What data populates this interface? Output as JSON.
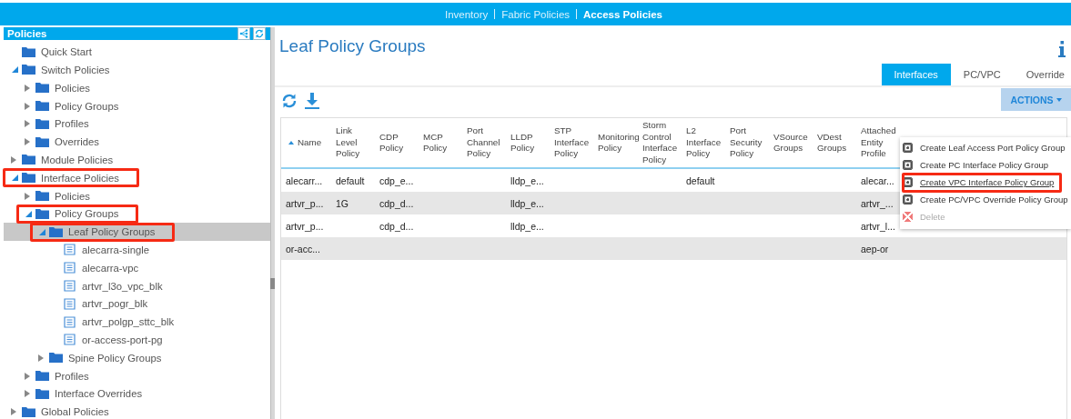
{
  "top_nav": [
    {
      "label": "Inventory",
      "selected": false
    },
    {
      "label": "Fabric Policies",
      "selected": false
    },
    {
      "label": "Access Policies",
      "selected": true
    }
  ],
  "sidebar": {
    "title": "Policies",
    "tree": [
      {
        "label": "Quick Start",
        "kind": "folder"
      },
      {
        "label": "Switch Policies",
        "kind": "folder",
        "expanded": true,
        "children": [
          {
            "label": "Policies",
            "kind": "folder",
            "expanded": false
          },
          {
            "label": "Policy Groups",
            "kind": "folder",
            "expanded": false
          },
          {
            "label": "Profiles",
            "kind": "folder",
            "expanded": false
          },
          {
            "label": "Overrides",
            "kind": "folder",
            "expanded": false
          }
        ]
      },
      {
        "label": "Module Policies",
        "kind": "folder",
        "expanded": false
      },
      {
        "label": "Interface Policies",
        "kind": "folder",
        "expanded": true,
        "highlighted": true,
        "children": [
          {
            "label": "Policies",
            "kind": "folder",
            "expanded": false
          },
          {
            "label": "Policy Groups",
            "kind": "folder",
            "expanded": true,
            "highlighted": true,
            "children": [
              {
                "label": "Leaf Policy Groups",
                "kind": "folder",
                "expanded": true,
                "selected": true,
                "highlighted": true,
                "children": [
                  {
                    "label": "alecarra-single",
                    "kind": "document"
                  },
                  {
                    "label": "alecarra-vpc",
                    "kind": "document"
                  },
                  {
                    "label": "artvr_l3o_vpc_blk",
                    "kind": "document"
                  },
                  {
                    "label": "artvr_pogr_blk",
                    "kind": "document"
                  },
                  {
                    "label": "artvr_polgp_sttc_blk",
                    "kind": "document"
                  },
                  {
                    "label": "or-access-port-pg",
                    "kind": "document"
                  }
                ]
              },
              {
                "label": "Spine Policy Groups",
                "kind": "folder",
                "expanded": false
              }
            ]
          },
          {
            "label": "Profiles",
            "kind": "folder",
            "expanded": false
          },
          {
            "label": "Interface Overrides",
            "kind": "folder",
            "expanded": false
          }
        ]
      },
      {
        "label": "Global Policies",
        "kind": "folder",
        "expanded": false
      }
    ]
  },
  "main": {
    "title": "Leaf Policy Groups",
    "tabs": [
      {
        "label": "Interfaces",
        "selected": true
      },
      {
        "label": "PC/VPC",
        "selected": false
      },
      {
        "label": "Override",
        "selected": false
      }
    ],
    "actions_button": "ACTIONS",
    "table": {
      "columns": [
        {
          "label": "Name",
          "sorted": true
        },
        {
          "label": "Link Level Policy",
          "sorted": false
        },
        {
          "label": "CDP Policy",
          "sorted": false
        },
        {
          "label": "MCP Policy",
          "sorted": false
        },
        {
          "label": "Port Channel Policy",
          "sorted": false
        },
        {
          "label": "LLDP Policy",
          "sorted": false
        },
        {
          "label": "STP Interface Policy",
          "sorted": false
        },
        {
          "label": "Monitoring Policy",
          "sorted": false
        },
        {
          "label": "Storm Control Interface Policy",
          "sorted": false
        },
        {
          "label": "L2 Interface Policy",
          "sorted": false
        },
        {
          "label": "Port Security Policy",
          "sorted": false
        },
        {
          "label": "VSource Groups",
          "sorted": false
        },
        {
          "label": "VDest Groups",
          "sorted": false
        },
        {
          "label": "Attached Entity Profile",
          "sorted": false
        }
      ],
      "rows": [
        [
          "alecarr...",
          "default",
          "cdp_e...",
          "",
          "",
          "lldp_e...",
          "",
          "",
          "",
          "default",
          "",
          "",
          "",
          "alecar..."
        ],
        [
          "artvr_p...",
          "1G",
          "cdp_d...",
          "",
          "",
          "lldp_e...",
          "",
          "",
          "",
          "",
          "",
          "",
          "",
          "artvr_..."
        ],
        [
          "artvr_p...",
          "",
          "cdp_d...",
          "",
          "",
          "lldp_e...",
          "",
          "",
          "",
          "",
          "",
          "",
          "",
          "artvr_l..."
        ],
        [
          "or-acc...",
          "",
          "",
          "",
          "",
          "",
          "",
          "",
          "",
          "",
          "",
          "",
          "",
          "aep-or"
        ]
      ]
    },
    "actions_menu": [
      {
        "label": "Create Leaf Access Port Policy Group",
        "kind": "create",
        "disabled": false,
        "highlighted": false
      },
      {
        "label": "Create PC Interface Policy Group",
        "kind": "create",
        "disabled": false,
        "highlighted": false
      },
      {
        "label": "Create VPC Interface Policy Group",
        "kind": "create",
        "disabled": false,
        "highlighted": true
      },
      {
        "label": "Create PC/VPC Override Policy Group",
        "kind": "create",
        "disabled": false,
        "highlighted": false
      },
      {
        "label": "Delete",
        "kind": "delete",
        "disabled": true,
        "highlighted": false
      }
    ]
  }
}
